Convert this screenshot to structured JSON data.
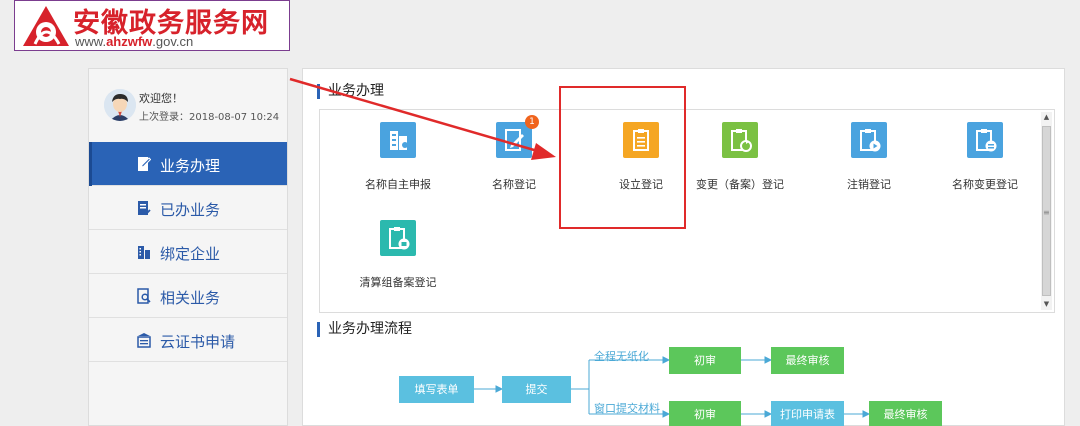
{
  "logo": {
    "title": "安徽政务服务网",
    "url_prefix": "www.",
    "url_brand": "ahzwfw",
    "url_suffix": ".gov.cn"
  },
  "user": {
    "welcome": "欢迎您！",
    "last_login": "上次登录：2018-08-07 10:24"
  },
  "sidebar": {
    "items": [
      {
        "label": "业务办理",
        "icon": "document-edit-icon",
        "active": true
      },
      {
        "label": "已办业务",
        "icon": "document-check-icon",
        "active": false
      },
      {
        "label": "绑定企业",
        "icon": "building-icon",
        "active": false
      },
      {
        "label": "相关业务",
        "icon": "document-search-icon",
        "active": false
      },
      {
        "label": "云证书申请",
        "icon": "certificate-icon",
        "active": false
      }
    ]
  },
  "services": {
    "title": "业务办理",
    "items": [
      {
        "label": "名称自主申报",
        "color": "#4aa3df",
        "icon": "building-icon"
      },
      {
        "label": "名称登记",
        "color": "#4aa3df",
        "icon": "document-edit-icon",
        "badge": "1"
      },
      {
        "label": "设立登记",
        "color": "#f5a623",
        "icon": "clipboard-icon"
      },
      {
        "label": "变更（备案）登记",
        "color": "#7bc143",
        "icon": "clipboard-refresh-icon"
      },
      {
        "label": "注销登记",
        "color": "#4aa3df",
        "icon": "clipboard-cancel-icon"
      },
      {
        "label": "名称变更登记",
        "color": "#4aa3df",
        "icon": "clipboard-list-icon"
      },
      {
        "label": "清算组备案登记",
        "color": "#2bb9ae",
        "icon": "clipboard-stamp-icon"
      }
    ]
  },
  "flow": {
    "title": "业务办理流程",
    "start": "填写表单",
    "submit": "提交",
    "path1_label": "全程无纸化",
    "path2_label": "窗口提交材料",
    "initial_review": "初审",
    "final_review": "最终审核",
    "print_form": "打印申请表"
  }
}
